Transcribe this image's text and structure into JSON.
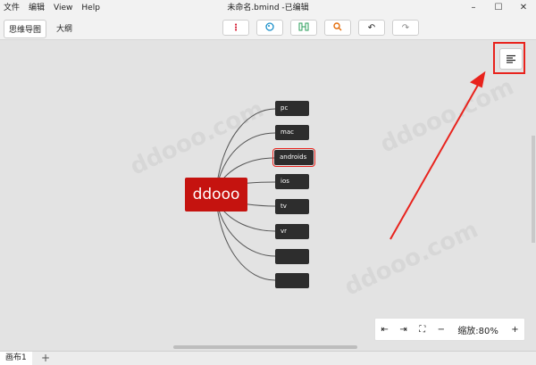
{
  "menu": {
    "items": [
      "文件",
      "编辑",
      "View",
      "Help"
    ]
  },
  "window": {
    "title": "未命名.bmind -已编辑",
    "minimize": "–",
    "maximize": "☐",
    "close": "✕"
  },
  "viewtabs": {
    "mindmap": "思维导图",
    "outline": "大纲"
  },
  "toolbar": {
    "icons": [
      "more-icon",
      "palette-icon",
      "structure-icon",
      "search-icon",
      "undo-icon",
      "redo-icon"
    ],
    "more": "⋮",
    "palette": "🎨",
    "structure": "⧉",
    "search": "🔍",
    "undo": "↶",
    "redo": "↷"
  },
  "canvas": {
    "watermark": "ddooo.com"
  },
  "mindmap": {
    "central": "ddooo",
    "topics": [
      "pc",
      "mac",
      "androids",
      "ios",
      "tv",
      "vr",
      "",
      ""
    ],
    "selected_topic": "androids",
    "colors": {
      "central": "#c5130f",
      "topic": "#2d2d2d",
      "highlight": "#e8231d"
    }
  },
  "zoom": {
    "label": "缩放:80%",
    "minus": "−",
    "plus": "+"
  },
  "sheets": {
    "tab": "画布1",
    "add": "+"
  }
}
